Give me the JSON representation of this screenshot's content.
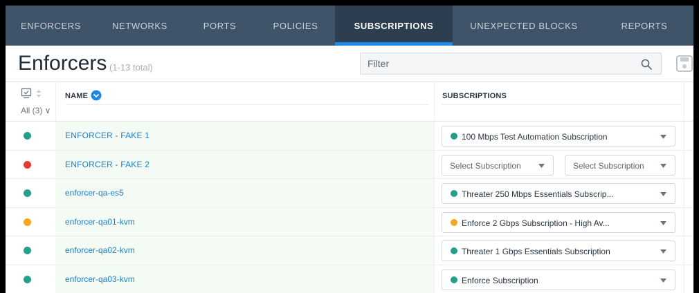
{
  "nav": {
    "tabs": [
      {
        "label": "ENFORCERS"
      },
      {
        "label": "NETWORKS"
      },
      {
        "label": "PORTS"
      },
      {
        "label": "POLICIES"
      },
      {
        "label": "SUBSCRIPTIONS"
      },
      {
        "label": "UNEXPECTED BLOCKS"
      },
      {
        "label": "REPORTS"
      }
    ]
  },
  "header": {
    "title": "Enforcers",
    "total": "(1-13 total)",
    "filter_placeholder": "Filter"
  },
  "table": {
    "status_filter": "All (3) ∨",
    "col_name": "NAME",
    "col_subscriptions": "SUBSCRIPTIONS",
    "rows": [
      {
        "status": "#26a08a",
        "name": "ENFORCER - FAKE 1",
        "sub_color": "#26a08a",
        "subscription": "100 Mbps Test Automation Subscription"
      },
      {
        "status": "#e53935",
        "name": "ENFORCER - FAKE 2",
        "select_a": "Select Subscription",
        "select_b": "Select Subscription"
      },
      {
        "status": "#26a08a",
        "name": "enforcer-qa-es5",
        "sub_color": "#26a08a",
        "subscription": "Threater 250 Mbps Essentials Subscrip..."
      },
      {
        "status": "#f5a623",
        "name": "enforcer-qa01-kvm",
        "sub_color": "#f5a623",
        "subscription": "Enforce 2 Gbps Subscription - High Av..."
      },
      {
        "status": "#26a08a",
        "name": "enforcer-qa02-kvm",
        "sub_color": "#26a08a",
        "subscription": "Threater 1 Gbps Essentials Subscription"
      },
      {
        "status": "#26a08a",
        "name": "enforcer-qa03-kvm",
        "sub_color": "#26a08a",
        "subscription": "Enforce Subscription"
      }
    ]
  },
  "colors": {
    "nav_bg": "#3f5468",
    "nav_active_bg": "#2d3e50",
    "nav_active_underline": "#1e88e5",
    "link": "#1b7fc4",
    "status_ok": "#26a08a",
    "status_error": "#e53935",
    "status_warn": "#f5a623"
  },
  "icons": {
    "search": "search-icon",
    "save": "save-icon",
    "status_head": "monitor-check-icon",
    "sort": "sort-icon",
    "name_sort": "chevron-down-circle-icon",
    "caret": "caret-down-icon"
  }
}
